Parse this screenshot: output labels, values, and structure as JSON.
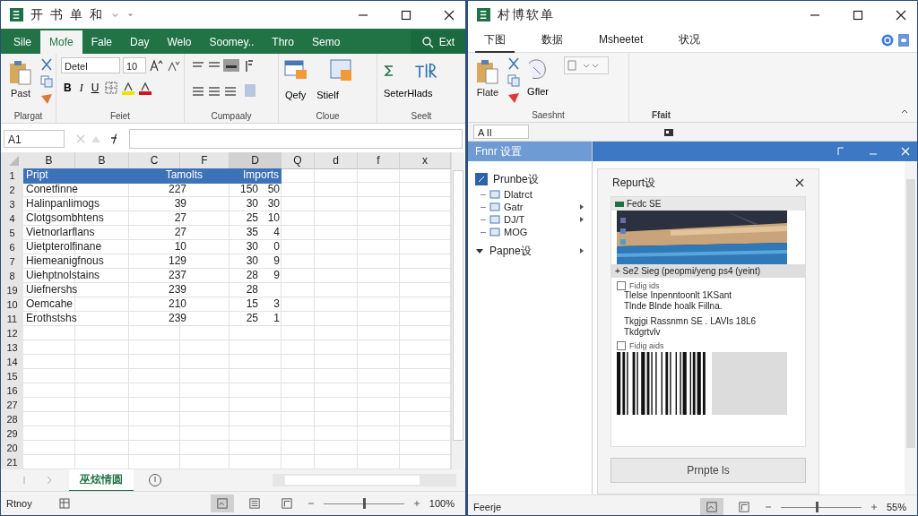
{
  "left_window": {
    "title": "开 书 单  和",
    "ribbon_tabs": [
      {
        "label": "Sile",
        "selected": false
      },
      {
        "label": "Mofe",
        "selected": true
      },
      {
        "label": "Fale",
        "selected": false
      },
      {
        "label": "Day",
        "selected": false
      },
      {
        "label": "Welo",
        "selected": false
      },
      {
        "label": "Soomey..",
        "selected": false
      },
      {
        "label": "Thro",
        "selected": false
      },
      {
        "label": "Semo",
        "selected": false
      }
    ],
    "tell_me": "Ext",
    "ribbon_groups": [
      {
        "kind": "clipboard",
        "label": "Plargat",
        "buttons": [
          "Past"
        ]
      },
      {
        "kind": "font",
        "label": "Feiet",
        "font": "Detel",
        "size": "10",
        "buttons": [
          "B",
          "I",
          "U"
        ]
      },
      {
        "kind": "alignment",
        "label": "Cumpaaly"
      },
      {
        "kind": "cells",
        "label": "Cloue",
        "buttons": [
          "Qefy",
          "Stielf"
        ]
      },
      {
        "kind": "editing",
        "label": "Seelt",
        "buttons": [
          "SeterHlads"
        ]
      }
    ],
    "name_box": "A1",
    "columns": [
      "B",
      "B",
      "C",
      "F",
      "D",
      "Q",
      "d",
      "f",
      "x"
    ],
    "rows": [
      {
        "num": "1",
        "kind": "header",
        "cells": [
          "Pript",
          "Tamolts",
          "Imports"
        ]
      },
      {
        "num": "2",
        "kind": "data",
        "cells": [
          "Conetfinne",
          "227",
          "150",
          "50"
        ]
      },
      {
        "num": "3",
        "kind": "data",
        "cells": [
          "Halinpanlimogs",
          "39",
          "30",
          "30"
        ]
      },
      {
        "num": "4",
        "kind": "data",
        "cells": [
          "Clotgsombhtens",
          "27",
          "25",
          "10"
        ]
      },
      {
        "num": "5",
        "kind": "data",
        "cells": [
          "Vietnorlarflans",
          "27",
          "35",
          "4"
        ]
      },
      {
        "num": "6",
        "kind": "data",
        "cells": [
          "Uietpterolfinane",
          "10",
          "30",
          "0"
        ]
      },
      {
        "num": "7",
        "kind": "data",
        "cells": [
          "Hiemeanigfnous",
          "129",
          "30",
          "9"
        ]
      },
      {
        "num": "8",
        "kind": "data",
        "cells": [
          "Uiehptnolstains",
          "237",
          "28",
          "9"
        ]
      },
      {
        "num": "19",
        "kind": "data",
        "cells": [
          "Uiefnershs",
          "239",
          "28"
        ]
      },
      {
        "num": "10",
        "kind": "data",
        "cells": [
          "Oemcahe",
          "210",
          "15",
          "3"
        ]
      },
      {
        "num": "11",
        "kind": "data",
        "cells": [
          "Erothstshs",
          "239",
          "25",
          "1"
        ]
      },
      {
        "num": "12",
        "kind": "empty"
      },
      {
        "num": "13",
        "kind": "empty"
      },
      {
        "num": "14",
        "kind": "empty"
      },
      {
        "num": "15",
        "kind": "empty"
      },
      {
        "num": "16",
        "kind": "empty"
      },
      {
        "num": "27",
        "kind": "empty"
      },
      {
        "num": "28",
        "kind": "empty"
      },
      {
        "num": "29",
        "kind": "empty"
      },
      {
        "num": "20",
        "kind": "empty"
      },
      {
        "num": "21",
        "kind": "empty"
      }
    ],
    "sheet_tabs": [
      {
        "label": "巫炫情圆",
        "selected": true
      }
    ],
    "status": "Rtnoy",
    "views": [
      {
        "kind": "normal",
        "selected": true
      },
      {
        "kind": "layout",
        "selected": false
      },
      {
        "kind": "break",
        "selected": false
      }
    ],
    "zoom": {
      "level": 0.5,
      "reading": "100%"
    }
  },
  "right_window": {
    "title": "村博软单",
    "ribbon_tabs": [
      {
        "label": "下图",
        "selected": true
      },
      {
        "label": "数据",
        "selected": false
      },
      {
        "label": "Msheetet",
        "selected": false
      },
      {
        "label": "状况",
        "selected": false
      }
    ],
    "ribbon_groups": [
      {
        "kind": "clipboard",
        "label": "Saeshnt",
        "buttons": [
          "Flate",
          "Gfler"
        ]
      },
      {
        "kind": "empty",
        "label": "Ffait"
      }
    ],
    "name_box": "A II",
    "pane": {
      "title": "Fnnr 设置",
      "tree": [
        {
          "label": "Prunbe设",
          "expanded": true,
          "submenu": false,
          "children": [
            {
              "label": "Dlatrct",
              "submenu": false
            },
            {
              "label": "Gatr",
              "submenu": true
            },
            {
              "label": "DJ/T",
              "submenu": true
            },
            {
              "label": "MOG",
              "submenu": false
            }
          ]
        },
        {
          "label": "Papne设",
          "expanded": true,
          "submenu": true
        }
      ]
    },
    "dialog": {
      "title": "Repurt设",
      "list_header": "Fedc SE",
      "caption": "+ Se2 Sieg (peopmi/yeng ps4 (yeint)",
      "options": [
        {
          "label": "Fidig ids",
          "checked": false,
          "lines": [
            "Tlelse Inpenntoonlt 1KSant",
            "Tlnde Blnde hoalk Fillna.",
            "Tkgjgi Rassnmn SE . LAVIs 18L6",
            "Tkdgrtvlv"
          ]
        },
        {
          "label": "Fidig aids",
          "checked": false
        }
      ],
      "button": "Prnpte ls"
    },
    "status": "Feerje",
    "views": [
      {
        "kind": "normal",
        "selected": true
      },
      {
        "kind": "break",
        "selected": false
      }
    ],
    "zoom": {
      "level": 0.45,
      "reading": "55%"
    }
  }
}
